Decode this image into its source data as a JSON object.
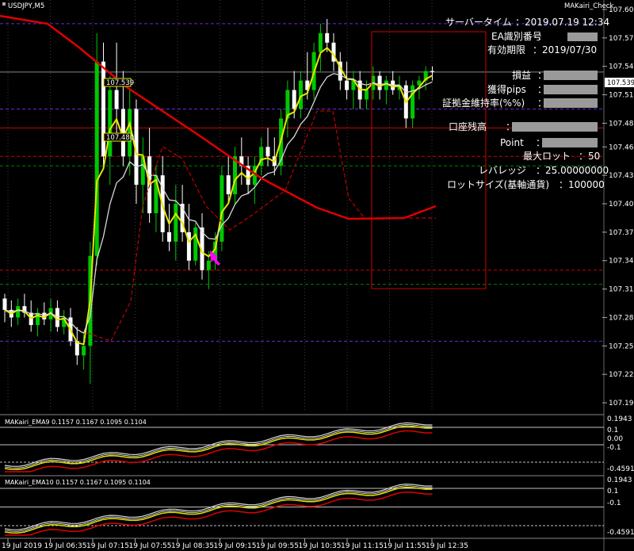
{
  "symbol_title": "USDJPY,M5",
  "indicator_title": "MAKairi_Check",
  "current_price_label": "107.539",
  "line_label_1": "107.539",
  "line_label_2": "107.480",
  "info_panel": {
    "server_time_label": "サーバータイム",
    "server_time_value": "：2019.07.19 12:34",
    "ea_id_label": "EA識別番号",
    "ea_id_value": "：",
    "expiry_label": "有効期限",
    "expiry_value": "：2019/07/30",
    "pnl_label": "損益",
    "pips_label": "獲得pips",
    "margin_label": "証拠金維持率(%%)",
    "balance_label": "口座残高",
    "point_label": "Point",
    "max_lot_label": "最大ロット",
    "max_lot_value": "：50",
    "leverage_label": "レバレッジ",
    "leverage_value": "：25.00000000",
    "lot_size_label": "ロットサイズ(基軸通貨)",
    "lot_size_value": "：100000",
    "colon": "："
  },
  "price_axis": [
    "107.605",
    "107.575",
    "107.545",
    "107.515",
    "107.485",
    "107.460",
    "107.430",
    "107.400",
    "107.370",
    "107.340",
    "107.310",
    "107.280",
    "107.250",
    "107.220",
    "107.190"
  ],
  "subpanel1": {
    "label": "MAKairi_EMA9 0.1157 0.1167 0.1095 0.1104",
    "axis": [
      "0.1943",
      "0.1",
      "0.00",
      "-0.1",
      "-0.4591"
    ]
  },
  "subpanel2": {
    "label": "MAKairi_EMA10 0.1157 0.1167 0.1095 0.1104",
    "axis": [
      "0.1943",
      "0.1",
      "-0.1",
      "-0.4591"
    ]
  },
  "time_axis": [
    "19 Jul 2019",
    "19 Jul 06:35",
    "19 Jul 07:15",
    "19 Jul 07:55",
    "19 Jul 08:35",
    "19 Jul 09:15",
    "19 Jul 09:55",
    "19 Jul 10:35",
    "19 Jul 11:15",
    "19 Jul 11:55",
    "19 Jul 12:35"
  ],
  "colors": {
    "bull": "#00c800",
    "bear": "#ffffff",
    "ema_fast": "#e6e600",
    "ema_slow": "#d8d8d8",
    "ma_long": "#e00000",
    "grid": "#3a3a3a",
    "purple_line": "#6a2ad8",
    "red_line": "#d00000",
    "green_line": "#008000",
    "arrow": "#ff00ff"
  },
  "chart_data": {
    "type": "candlestick",
    "symbol": "USDJPY,M5",
    "ylim": [
      107.18,
      107.615
    ],
    "candles": [
      [
        107.3,
        107.305,
        107.275,
        107.288
      ],
      [
        107.288,
        107.298,
        107.27,
        107.28
      ],
      [
        107.28,
        107.3,
        107.272,
        107.292
      ],
      [
        107.292,
        107.305,
        107.28,
        107.285
      ],
      [
        107.285,
        107.298,
        107.265,
        107.272
      ],
      [
        107.272,
        107.29,
        107.26,
        107.285
      ],
      [
        107.285,
        107.296,
        107.272,
        107.278
      ],
      [
        107.278,
        107.3,
        107.265,
        107.29
      ],
      [
        107.29,
        107.298,
        107.265,
        107.27
      ],
      [
        107.27,
        107.288,
        107.262,
        107.28
      ],
      [
        107.28,
        107.29,
        107.25,
        107.255
      ],
      [
        107.255,
        107.27,
        107.23,
        107.24
      ],
      [
        107.24,
        107.262,
        107.225,
        107.25
      ],
      [
        107.25,
        107.36,
        107.21,
        107.345
      ],
      [
        107.345,
        107.58,
        107.335,
        107.55
      ],
      [
        107.55,
        107.57,
        107.44,
        107.45
      ],
      [
        107.45,
        107.535,
        107.42,
        107.52
      ],
      [
        107.52,
        107.57,
        107.47,
        107.5
      ],
      [
        107.5,
        107.54,
        107.44,
        107.45
      ],
      [
        107.45,
        107.52,
        107.43,
        107.5
      ],
      [
        107.5,
        107.51,
        107.4,
        107.42
      ],
      [
        107.42,
        107.47,
        107.39,
        107.45
      ],
      [
        107.45,
        107.48,
        107.38,
        107.39
      ],
      [
        107.39,
        107.44,
        107.37,
        107.43
      ],
      [
        107.43,
        107.45,
        107.36,
        107.37
      ],
      [
        107.37,
        107.4,
        107.35,
        107.36
      ],
      [
        107.36,
        107.42,
        107.34,
        107.4
      ],
      [
        107.4,
        107.42,
        107.36,
        107.37
      ],
      [
        107.37,
        107.4,
        107.33,
        107.34
      ],
      [
        107.34,
        107.38,
        107.335,
        107.375
      ],
      [
        107.375,
        107.39,
        107.32,
        107.33
      ],
      [
        107.33,
        107.35,
        107.31,
        107.34
      ],
      [
        107.34,
        107.37,
        107.33,
        107.36
      ],
      [
        107.36,
        107.44,
        107.35,
        107.43
      ],
      [
        107.43,
        107.45,
        107.4,
        107.41
      ],
      [
        107.41,
        107.46,
        107.4,
        107.45
      ],
      [
        107.45,
        107.47,
        107.42,
        107.44
      ],
      [
        107.44,
        107.45,
        107.41,
        107.42
      ],
      [
        107.42,
        107.45,
        107.4,
        107.44
      ],
      [
        107.44,
        107.47,
        107.43,
        107.46
      ],
      [
        107.46,
        107.48,
        107.44,
        107.45
      ],
      [
        107.45,
        107.47,
        107.43,
        107.44
      ],
      [
        107.44,
        107.5,
        107.43,
        107.49
      ],
      [
        107.49,
        107.53,
        107.47,
        107.52
      ],
      [
        107.52,
        107.54,
        107.49,
        107.5
      ],
      [
        107.5,
        107.54,
        107.49,
        107.53
      ],
      [
        107.53,
        107.56,
        107.51,
        107.52
      ],
      [
        107.52,
        107.57,
        107.51,
        107.56
      ],
      [
        107.56,
        107.59,
        107.54,
        107.58
      ],
      [
        107.58,
        107.595,
        107.56,
        107.57
      ],
      [
        107.57,
        107.58,
        107.54,
        107.55
      ],
      [
        107.55,
        107.56,
        107.52,
        107.53
      ],
      [
        107.53,
        107.55,
        107.51,
        107.52
      ],
      [
        107.52,
        107.54,
        107.5,
        107.53
      ],
      [
        107.53,
        107.54,
        107.5,
        107.51
      ],
      [
        107.51,
        107.53,
        107.5,
        107.52
      ],
      [
        107.52,
        107.545,
        107.51,
        107.535
      ],
      [
        107.535,
        107.54,
        107.51,
        107.52
      ],
      [
        107.52,
        107.535,
        107.505,
        107.53
      ],
      [
        107.53,
        107.54,
        107.515,
        107.52
      ],
      [
        107.52,
        107.535,
        107.51,
        107.525
      ],
      [
        107.525,
        107.53,
        107.48,
        107.49
      ],
      [
        107.49,
        107.53,
        107.48,
        107.525
      ],
      [
        107.525,
        107.535,
        107.51,
        107.53
      ],
      [
        107.53,
        107.545,
        107.52,
        107.54
      ],
      [
        107.54,
        107.545,
        107.53,
        107.539
      ]
    ],
    "levels": [
      107.539,
      107.48,
      107.33
    ]
  }
}
